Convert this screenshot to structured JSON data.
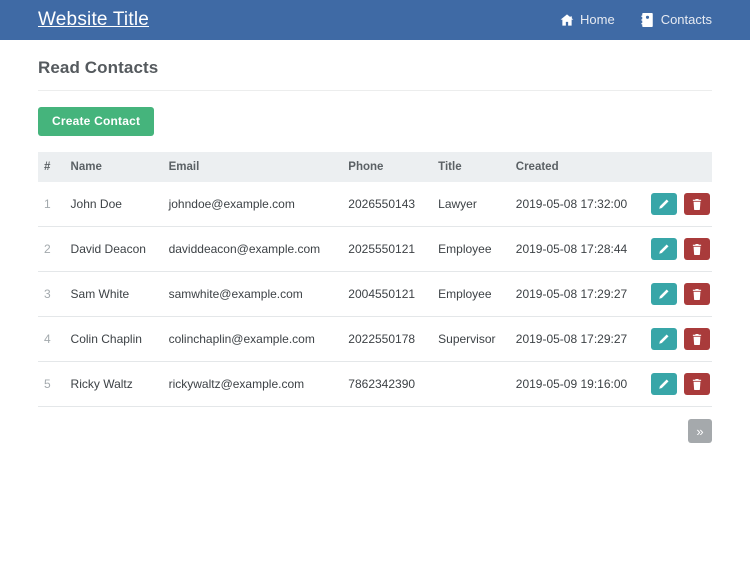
{
  "navbar": {
    "brand": "Website Title",
    "bg_color": "#3f6aa5",
    "links": [
      {
        "label": "Home",
        "icon": "home-icon"
      },
      {
        "label": "Contacts",
        "icon": "address-book-icon"
      }
    ]
  },
  "page": {
    "title": "Read Contacts",
    "create_button": "Create Contact",
    "create_button_color": "#45b47c"
  },
  "table": {
    "headers": [
      "#",
      "Name",
      "Email",
      "Phone",
      "Title",
      "Created"
    ],
    "rows": [
      {
        "index": "1",
        "name": "John Doe",
        "email": "johndoe@example.com",
        "phone": "2026550143",
        "title": "Lawyer",
        "created": "2019-05-08 17:32:00"
      },
      {
        "index": "2",
        "name": "David Deacon",
        "email": "daviddeacon@example.com",
        "phone": "2025550121",
        "title": "Employee",
        "created": "2019-05-08 17:28:44"
      },
      {
        "index": "3",
        "name": "Sam White",
        "email": "samwhite@example.com",
        "phone": "2004550121",
        "title": "Employee",
        "created": "2019-05-08 17:29:27"
      },
      {
        "index": "4",
        "name": "Colin Chaplin",
        "email": "colinchaplin@example.com",
        "phone": "2022550178",
        "title": "Supervisor",
        "created": "2019-05-08 17:29:27"
      },
      {
        "index": "5",
        "name": "Ricky Waltz",
        "email": "rickywaltz@example.com",
        "phone": "7862342390",
        "title": "",
        "created": "2019-05-09 19:16:00"
      }
    ],
    "row_actions": {
      "edit_icon": "pencil-icon",
      "edit_color": "#38a6a8",
      "delete_icon": "trash-icon",
      "delete_color": "#a93b3b"
    }
  },
  "pagination": {
    "next_label": "»",
    "button_color": "#a5a9ac"
  }
}
